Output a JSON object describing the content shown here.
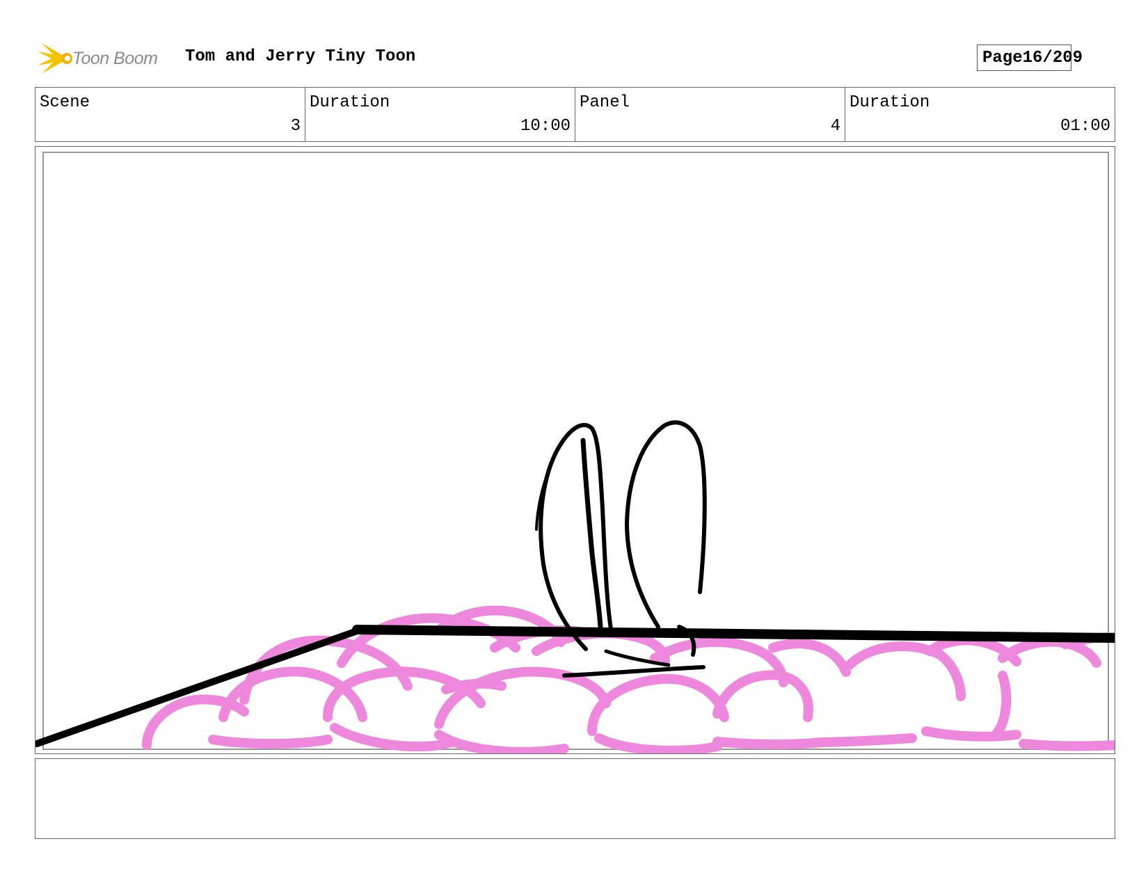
{
  "header": {
    "logo_text": "Toon Boom",
    "project_title": "Tom and Jerry Tiny Toon",
    "page_label": "Page",
    "page_number": "16/209"
  },
  "info": {
    "scene_label": "Scene",
    "scene_value": "3",
    "scene_duration_label": "Duration",
    "scene_duration_value": "10:00",
    "panel_label": "Panel",
    "panel_value": "4",
    "panel_duration_label": "Duration",
    "panel_duration_value": "01:00"
  },
  "drawing": {
    "ink_color": "#000000",
    "cloud_color": "#ee88dd",
    "safe_frame_color": "#999999",
    "logo_burst_color": "#f5c400"
  },
  "notes": {
    "text": ""
  }
}
